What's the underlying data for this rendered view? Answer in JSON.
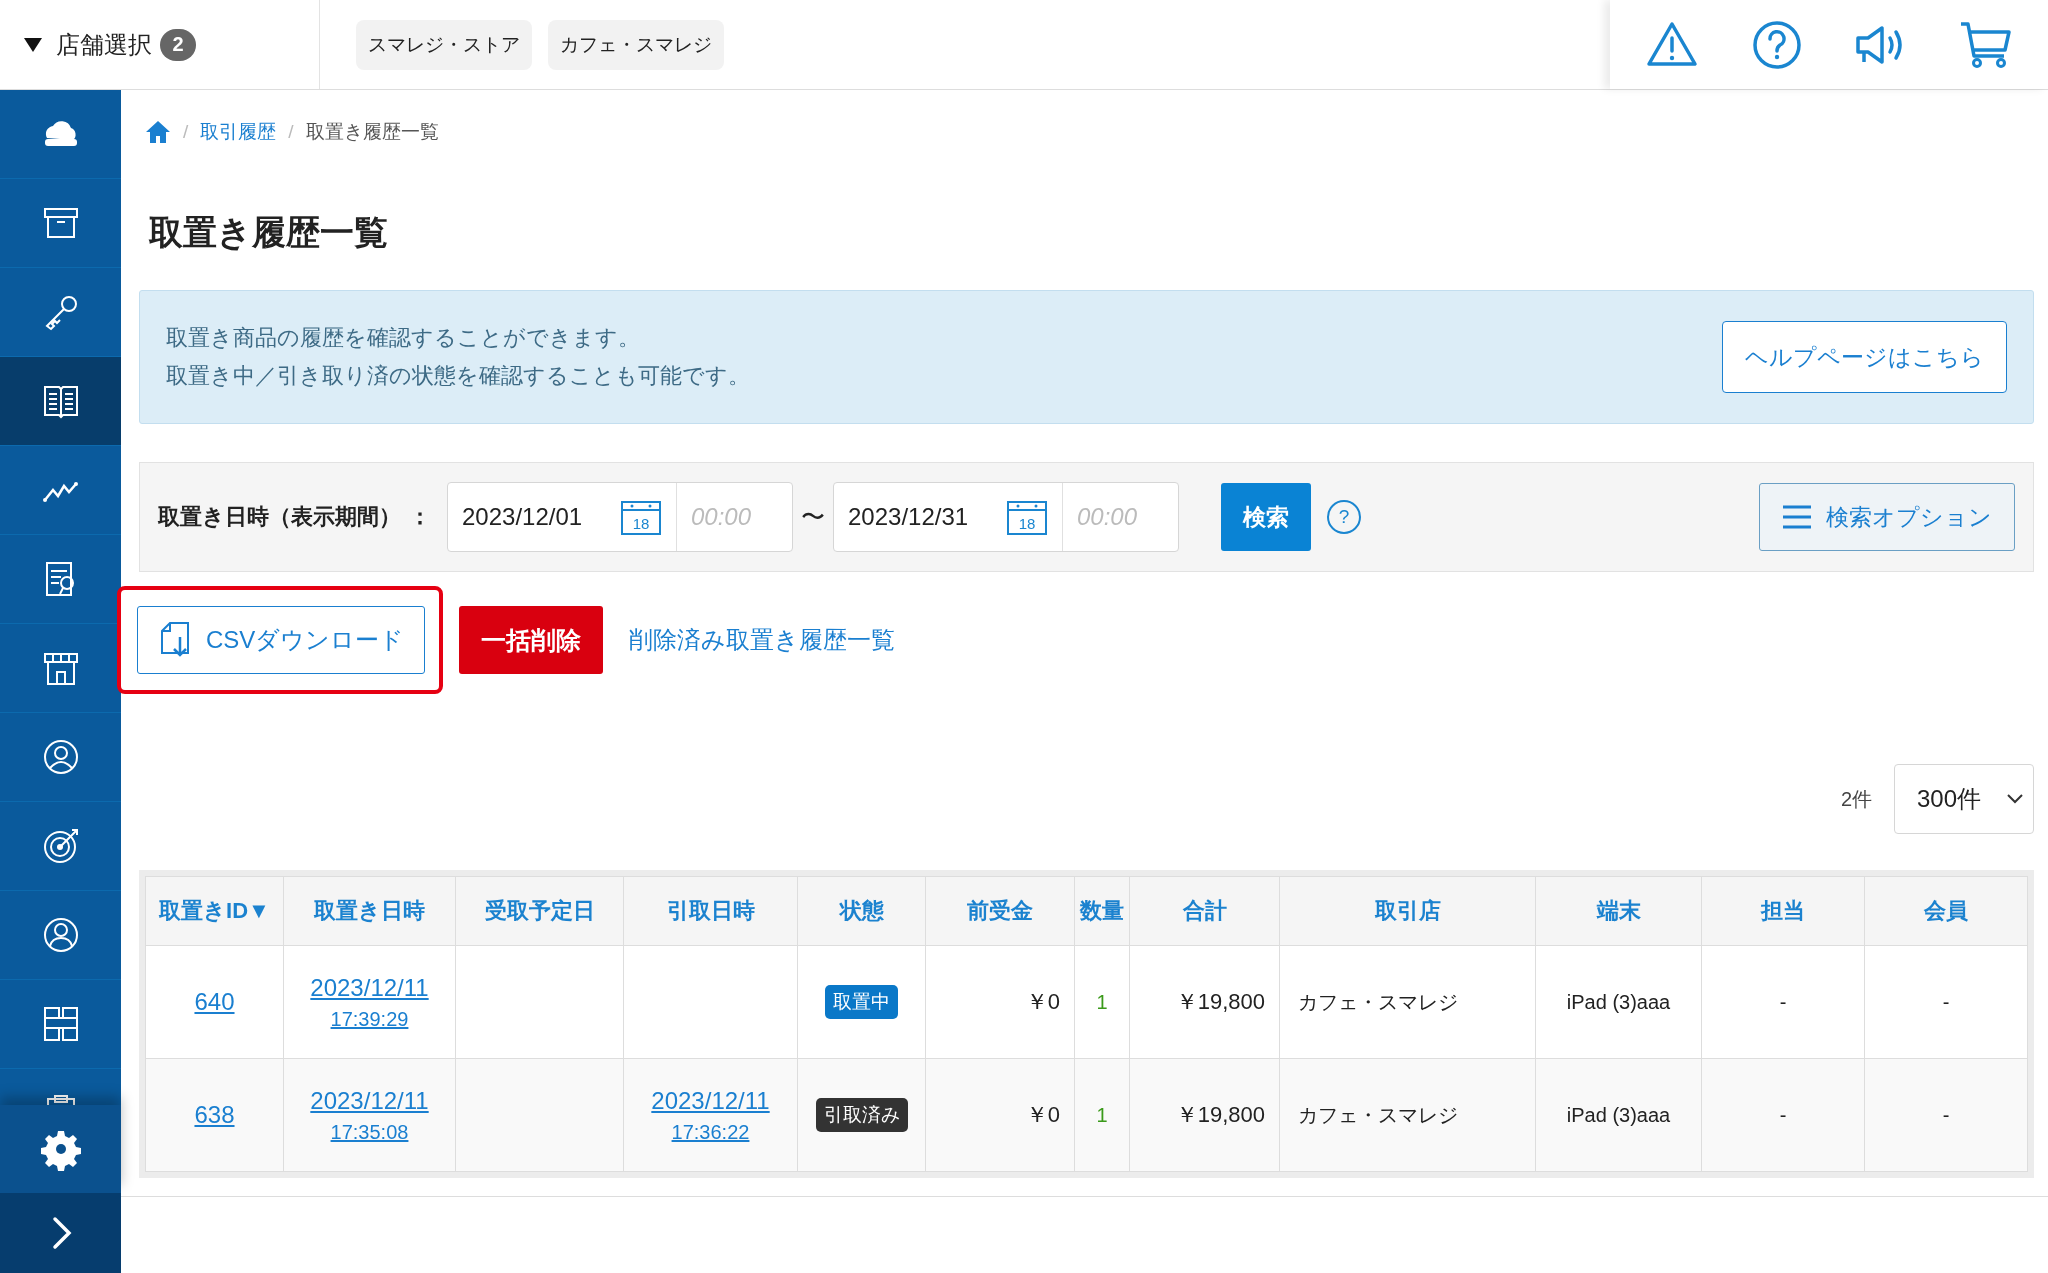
{
  "store_selector": {
    "label": "店舗選択",
    "count": "2"
  },
  "store_tags": [
    "スマレジ・ストア",
    "カフェ・スマレジ"
  ],
  "sidebar": {
    "items": [
      {
        "selected": false
      },
      {
        "selected": false
      },
      {
        "selected": false
      },
      {
        "selected": true
      },
      {
        "selected": false
      },
      {
        "selected": false
      },
      {
        "selected": false
      },
      {
        "selected": false
      },
      {
        "selected": false
      },
      {
        "selected": false
      },
      {
        "selected": false
      },
      {
        "selected": false
      }
    ]
  },
  "breadcrumb": [
    {
      "separator": "/",
      "label": "取引履歴",
      "link": true
    },
    {
      "separator": "/",
      "label": "取置き履歴一覧",
      "link": false
    }
  ],
  "page_title": "取置き履歴一覧",
  "info": {
    "lines": [
      "取置き商品の履歴を確認することができます。",
      "取置き中／引き取り済の状態を確認することも可能です。"
    ],
    "help_button": "ヘルプページはこちら"
  },
  "filter": {
    "label": "取置き日時（表示期間）",
    "separator": "：",
    "from": {
      "date": "2023/12/01",
      "calendar_day": "18",
      "time_placeholder": "00:00"
    },
    "range_mark": "〜",
    "to": {
      "date": "2023/12/31",
      "calendar_day": "18",
      "time_placeholder": "00:00"
    },
    "search_button": "検索",
    "help_mark": "?",
    "options_button": "検索オプション"
  },
  "actions": {
    "csv_button": {
      "label": "CSVダウンロード",
      "highlighted": true
    },
    "delete_button": "一括削除",
    "deleted_link": "削除済み取置き履歴一覧"
  },
  "result_count": "2件",
  "page_size": "300件",
  "table": {
    "columns": [
      "取置きID▼",
      "取置き日時",
      "受取予定日",
      "引取日時",
      "状態",
      "前受金",
      "数量",
      "合計",
      "取引店",
      "端末",
      "担当",
      "会員"
    ],
    "rows": [
      {
        "id": "640",
        "date": "2023/12/11",
        "time": "17:39:29",
        "status": {
          "text": "取置中",
          "kind": "reserved"
        },
        "deposit": "￥0",
        "quantity": "1",
        "total": "￥19,800",
        "store": "カフェ・スマレジ",
        "terminal": "iPad (3)aaa",
        "staff": "-",
        "member": "-"
      },
      {
        "id": "638",
        "date": "2023/12/11",
        "time": "17:35:08",
        "pickup_date": "2023/12/11",
        "pickup_time": "17:36:22",
        "status": {
          "text": "引取済み",
          "kind": "picked_up"
        },
        "deposit": "￥0",
        "quantity": "1",
        "total": "￥19,800",
        "store": "カフェ・スマレジ",
        "terminal": "iPad (3)aaa",
        "staff": "-",
        "member": "-"
      }
    ]
  }
}
